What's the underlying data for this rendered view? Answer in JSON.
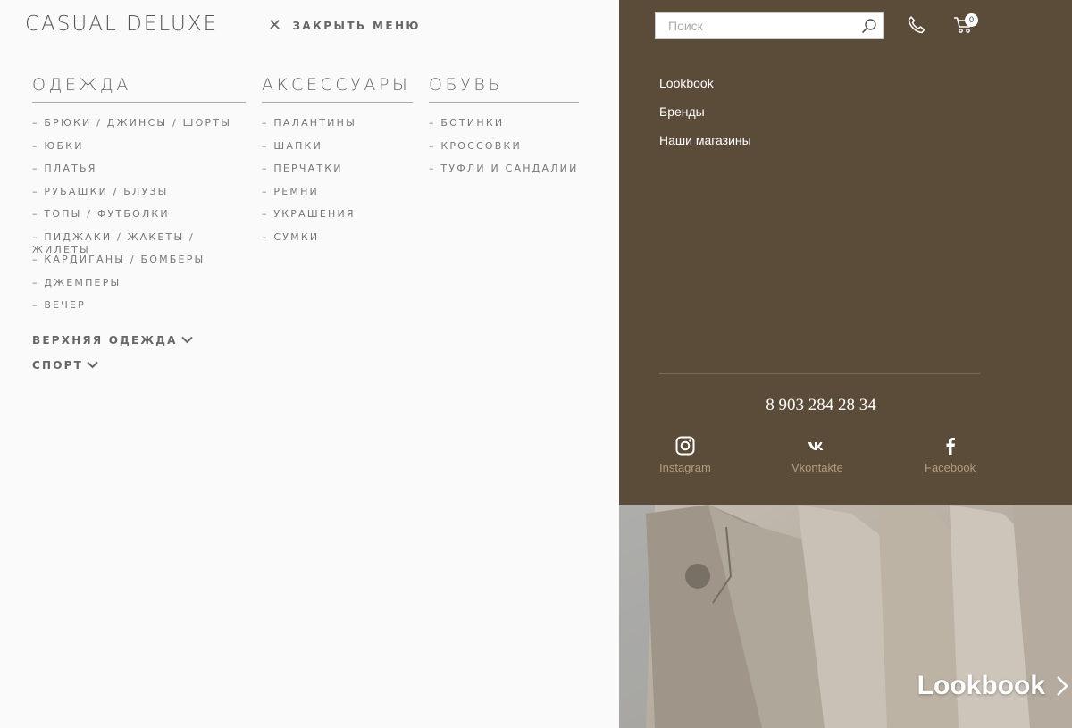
{
  "header": {
    "logo": "CASUAL DELUXE",
    "close_menu": "ЗАКРЫТЬ МЕНЮ"
  },
  "menu": {
    "clothing": {
      "title": "ОДЕЖДА",
      "items": [
        "– БРЮКИ / ДЖИНСЫ / ШОРТЫ",
        "– ЮБКИ",
        "– ПЛАТЬЯ",
        "– РУБАШКИ / БЛУЗЫ",
        "– ТОПЫ / ФУТБОЛКИ",
        "– ПИДЖАКИ / ЖАКЕТЫ / ЖИЛЕТЫ",
        "– КАРДИГАНЫ / БОМБЕРЫ",
        "– ДЖЕМПЕРЫ",
        "– ВЕЧЕР"
      ],
      "outerwear": "ВЕРХНЯЯ ОДЕЖДА",
      "sport": "СПОРТ"
    },
    "accessories": {
      "title": "АКСЕССУАРЫ",
      "items": [
        "– ПАЛАНТИНЫ",
        "– ШАПКИ",
        "– ПЕРЧАТКИ",
        "– РЕМНИ",
        "– УКРАШЕНИЯ",
        "– СУМКИ"
      ]
    },
    "shoes": {
      "title": "ОБУВЬ",
      "items": [
        "– БОТИНКИ",
        "– КРОССОВКИ",
        "– ТУФЛИ И САНДАЛИИ"
      ]
    }
  },
  "right_panel": {
    "search_placeholder": "Поиск",
    "cart_count": "0",
    "links": [
      "Lookbook",
      "Бренды",
      "Наши магазины"
    ],
    "phone": "8 903 284 28 34",
    "social": {
      "instagram": "Instagram",
      "vkontakte": "Vkontakte",
      "facebook": "Facebook"
    },
    "banner": "Lookbook"
  },
  "colors": {
    "panel_bg": "#5b4c39",
    "menu_bg": "#fafafa",
    "social_link": "#b39c7e"
  }
}
